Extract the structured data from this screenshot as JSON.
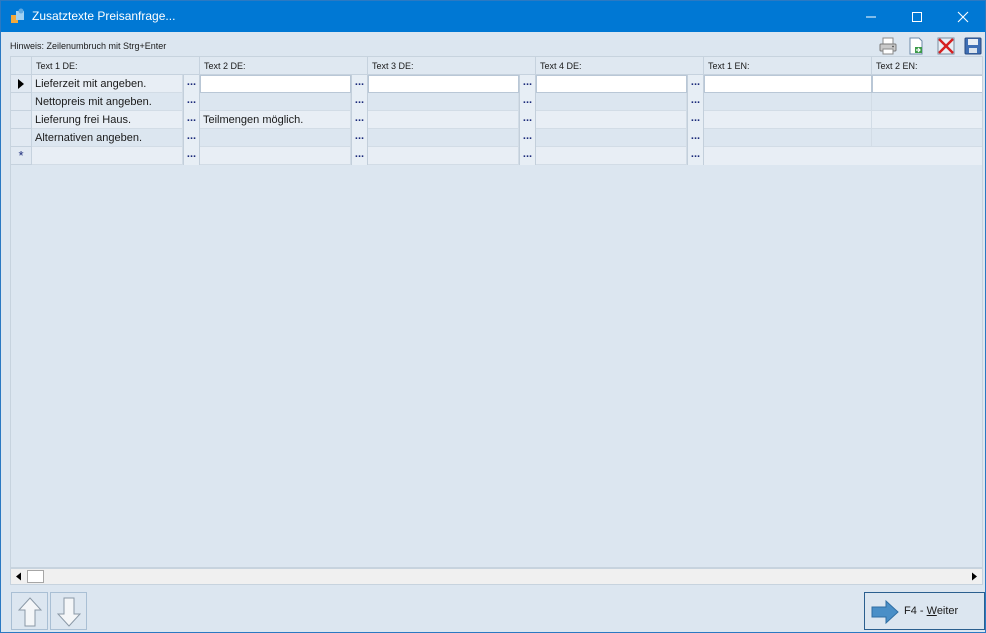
{
  "window": {
    "title": "Zusatztexte Preisanfrage..."
  },
  "hint": "Hinweis: Zeilenumbruch mit Strg+Enter",
  "toolbar": {
    "print_icon": "printer-icon",
    "export_icon": "export-icon",
    "delete_icon": "delete-icon",
    "save_icon": "save-icon"
  },
  "grid": {
    "columns": [
      "Text 1 DE:",
      "Text 2 DE:",
      "Text 3 DE:",
      "Text 4 DE:",
      "Text 1 EN:",
      "Text 2 EN:"
    ],
    "ellipsis": "...",
    "rows": [
      {
        "cells": [
          "Lieferzeit mit angeben.",
          "",
          "",
          "",
          "",
          ""
        ]
      },
      {
        "cells": [
          "Nettopreis mit angeben.",
          "",
          "",
          "",
          "",
          ""
        ]
      },
      {
        "cells": [
          "Lieferung frei Haus.",
          "Teilmengen möglich.",
          "",
          "",
          "",
          ""
        ]
      },
      {
        "cells": [
          "Alternativen angeben.",
          "",
          "",
          "",
          "",
          ""
        ]
      }
    ],
    "new_row_marker": "*",
    "current_row_marker": "▶"
  },
  "buttons": {
    "next_key": "F4 - ",
    "next_mnemonic": "W",
    "next_rest": "eiter"
  },
  "colors": {
    "titlebar": "#0078d4",
    "background": "#dce6f0",
    "ellipsis_text": "#1b2a7a",
    "arrow_blue": "#4a8fc7"
  }
}
